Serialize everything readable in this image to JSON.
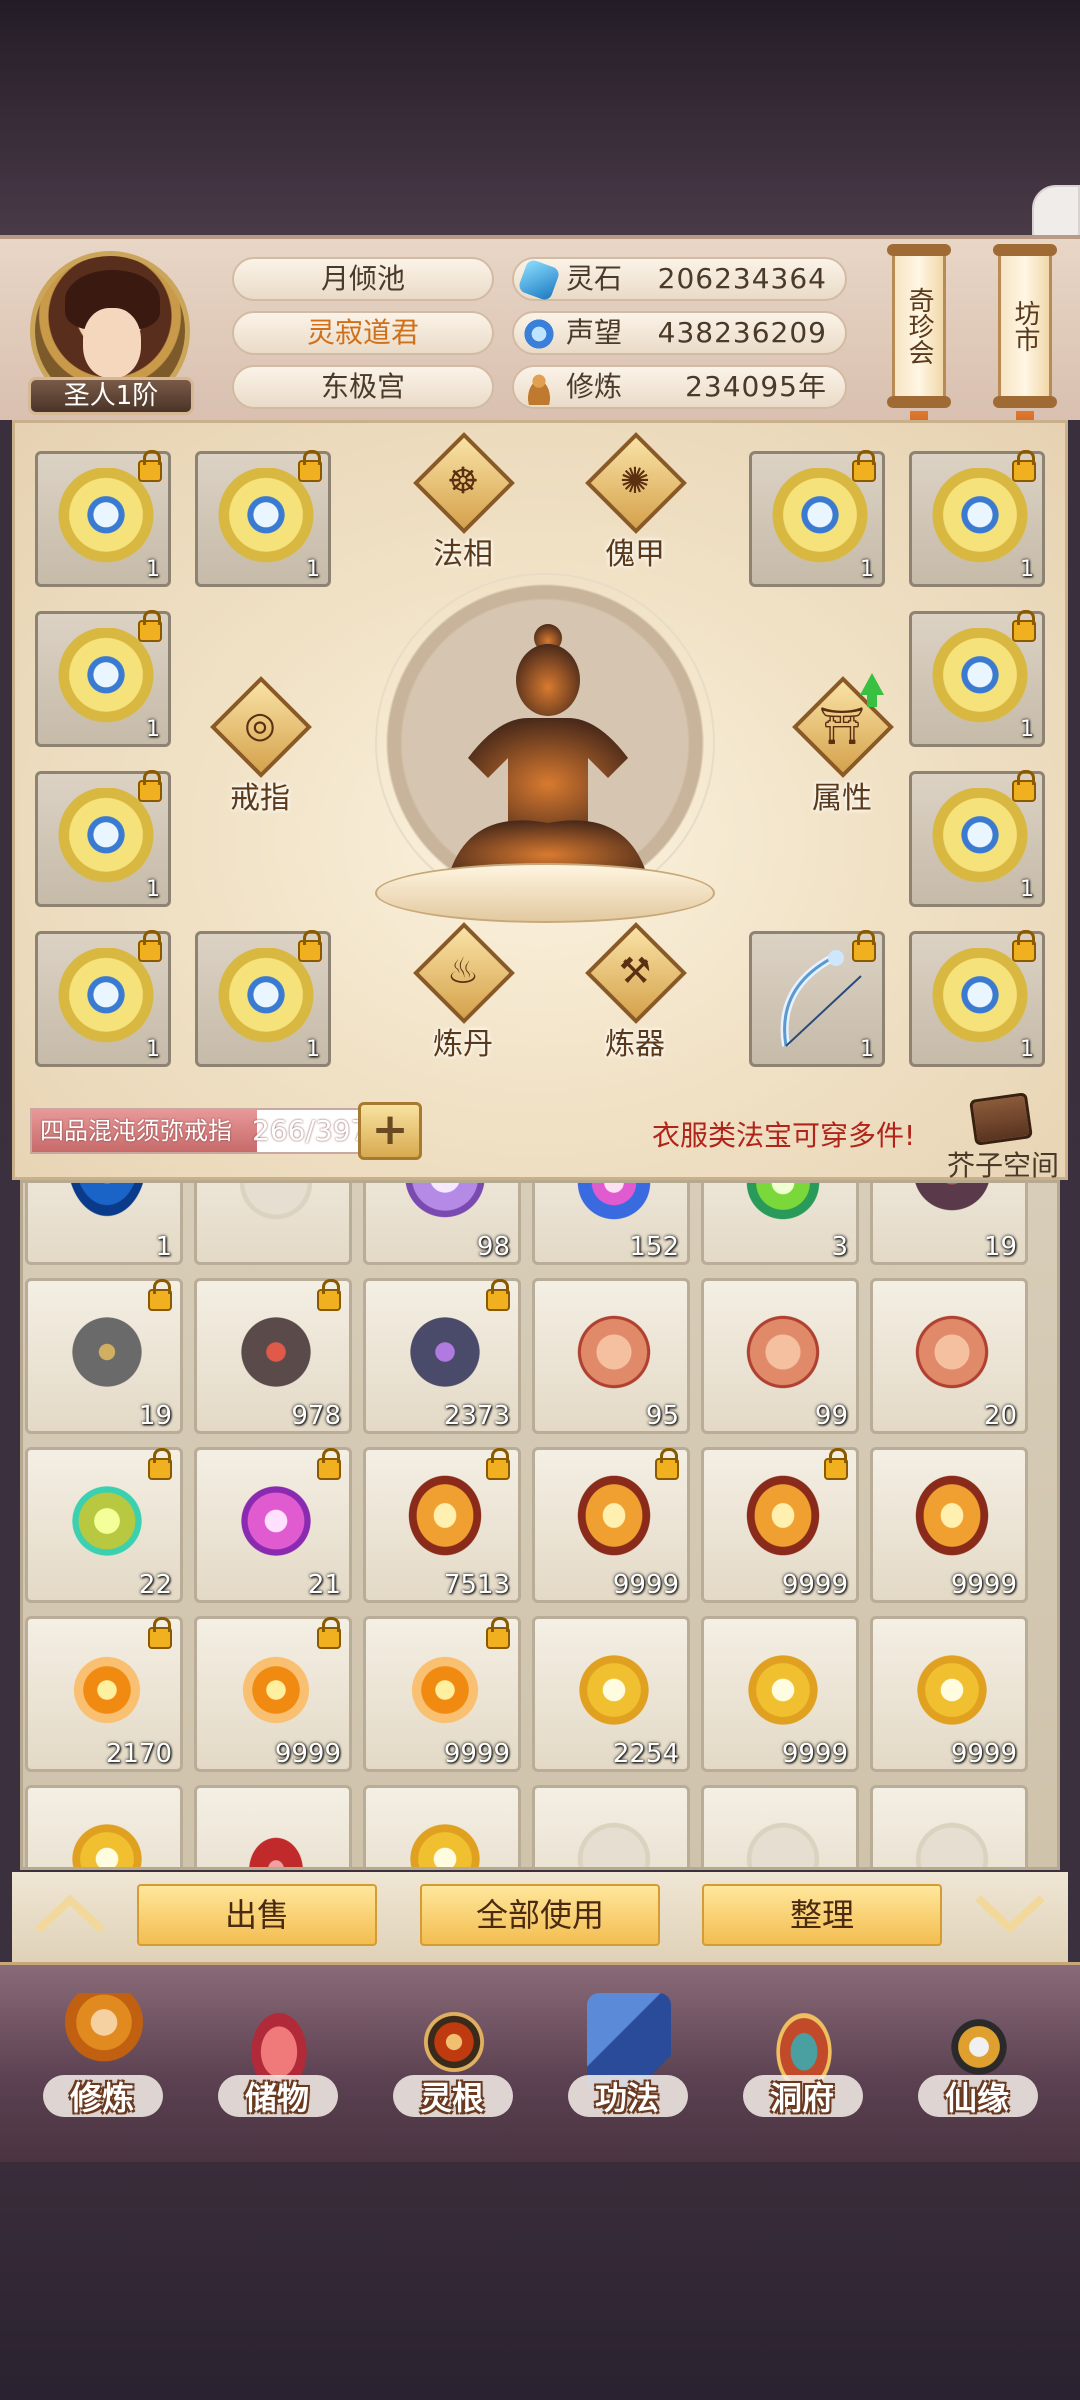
{
  "header": {
    "rank": "圣人1阶",
    "player_name": "月倾池",
    "title": "灵寂道君",
    "sect": "东极宫",
    "resources": [
      {
        "label": "灵石",
        "value": "206234364",
        "icon": "spirit-stone-icon",
        "color": "#3aa8e0"
      },
      {
        "label": "声望",
        "value": "438236209",
        "icon": "prestige-icon",
        "color": "#6ab0f0"
      },
      {
        "label": "修炼",
        "value": "234095年",
        "icon": "meditation-icon",
        "color": "#d08a30"
      }
    ],
    "scroll_buttons": [
      "奇珍会",
      "坊市"
    ]
  },
  "equipment": {
    "slot_count": "1",
    "center_buttons": {
      "faxiang": "法相",
      "kuijia": "傀甲",
      "jiezhi": "戒指",
      "shuxing": "属性",
      "liandan": "炼丹",
      "lianqi": "炼器"
    }
  },
  "capacity": {
    "label": "四品混沌须弥戒指",
    "count": "266/397",
    "fill_fraction": 0.67,
    "plus": "+",
    "hint": "衣服类法宝可穿多件!",
    "space_label": "芥子空间"
  },
  "inventory": {
    "rows": [
      [
        {
          "count": "1",
          "icon": "blue-vortex-icon",
          "locked": false
        },
        {
          "count": "",
          "icon": "empty-slot-icon",
          "locked": false
        },
        {
          "count": "98",
          "icon": "lotus-icon",
          "locked": false
        },
        {
          "count": "152",
          "icon": "flame-orb-icon",
          "locked": false
        },
        {
          "count": "3",
          "icon": "green-spirit-icon",
          "locked": false
        },
        {
          "count": "19",
          "icon": "dark-ore-icon",
          "locked": false
        }
      ],
      [
        {
          "count": "19",
          "icon": "gray-ore-icon",
          "locked": true
        },
        {
          "count": "978",
          "icon": "red-ore-icon",
          "locked": true
        },
        {
          "count": "2373",
          "icon": "purple-ore-icon",
          "locked": true
        },
        {
          "count": "95",
          "icon": "scroll-icon",
          "locked": false
        },
        {
          "count": "99",
          "icon": "scroll-icon",
          "locked": false
        },
        {
          "count": "20",
          "icon": "scroll-icon",
          "locked": false
        }
      ],
      [
        {
          "count": "22",
          "icon": "yellow-crystal-icon",
          "locked": true
        },
        {
          "count": "21",
          "icon": "pink-crystal-icon",
          "locked": true
        },
        {
          "count": "7513",
          "icon": "gold-sand-icon",
          "locked": true
        },
        {
          "count": "9999",
          "icon": "gold-sand-icon",
          "locked": true
        },
        {
          "count": "9999",
          "icon": "gold-sand-icon",
          "locked": true
        },
        {
          "count": "9999",
          "icon": "gold-sand-icon",
          "locked": false
        }
      ],
      [
        {
          "count": "2170",
          "icon": "fire-drop-icon",
          "locked": true
        },
        {
          "count": "9999",
          "icon": "fire-drop-icon",
          "locked": true
        },
        {
          "count": "9999",
          "icon": "fire-drop-icon",
          "locked": true
        },
        {
          "count": "2254",
          "icon": "golden-flame-icon",
          "locked": false
        },
        {
          "count": "9999",
          "icon": "golden-flame-icon",
          "locked": false
        },
        {
          "count": "9999",
          "icon": "golden-flame-icon",
          "locked": false
        }
      ],
      [
        {
          "count": "",
          "icon": "golden-flame-icon",
          "locked": false
        },
        {
          "count": "",
          "icon": "red-crystal-icon",
          "locked": false
        },
        {
          "count": "",
          "icon": "golden-flame-icon",
          "locked": false
        },
        {
          "count": "",
          "icon": "empty-slot-icon",
          "locked": false
        },
        {
          "count": "",
          "icon": "empty-slot-icon",
          "locked": false
        },
        {
          "count": "",
          "icon": "empty-slot-icon",
          "locked": false
        }
      ]
    ]
  },
  "actions": {
    "sell": "出售",
    "use_all": "全部使用",
    "sort": "整理"
  },
  "nav": [
    {
      "label": "修炼",
      "icon": "cultivator-icon"
    },
    {
      "label": "储物",
      "icon": "storage-bag-icon"
    },
    {
      "label": "灵根",
      "icon": "spirit-root-icon"
    },
    {
      "label": "功法",
      "icon": "technique-book-icon"
    },
    {
      "label": "洞府",
      "icon": "cave-abode-icon"
    },
    {
      "label": "仙缘",
      "icon": "immortal-fate-icon"
    }
  ]
}
